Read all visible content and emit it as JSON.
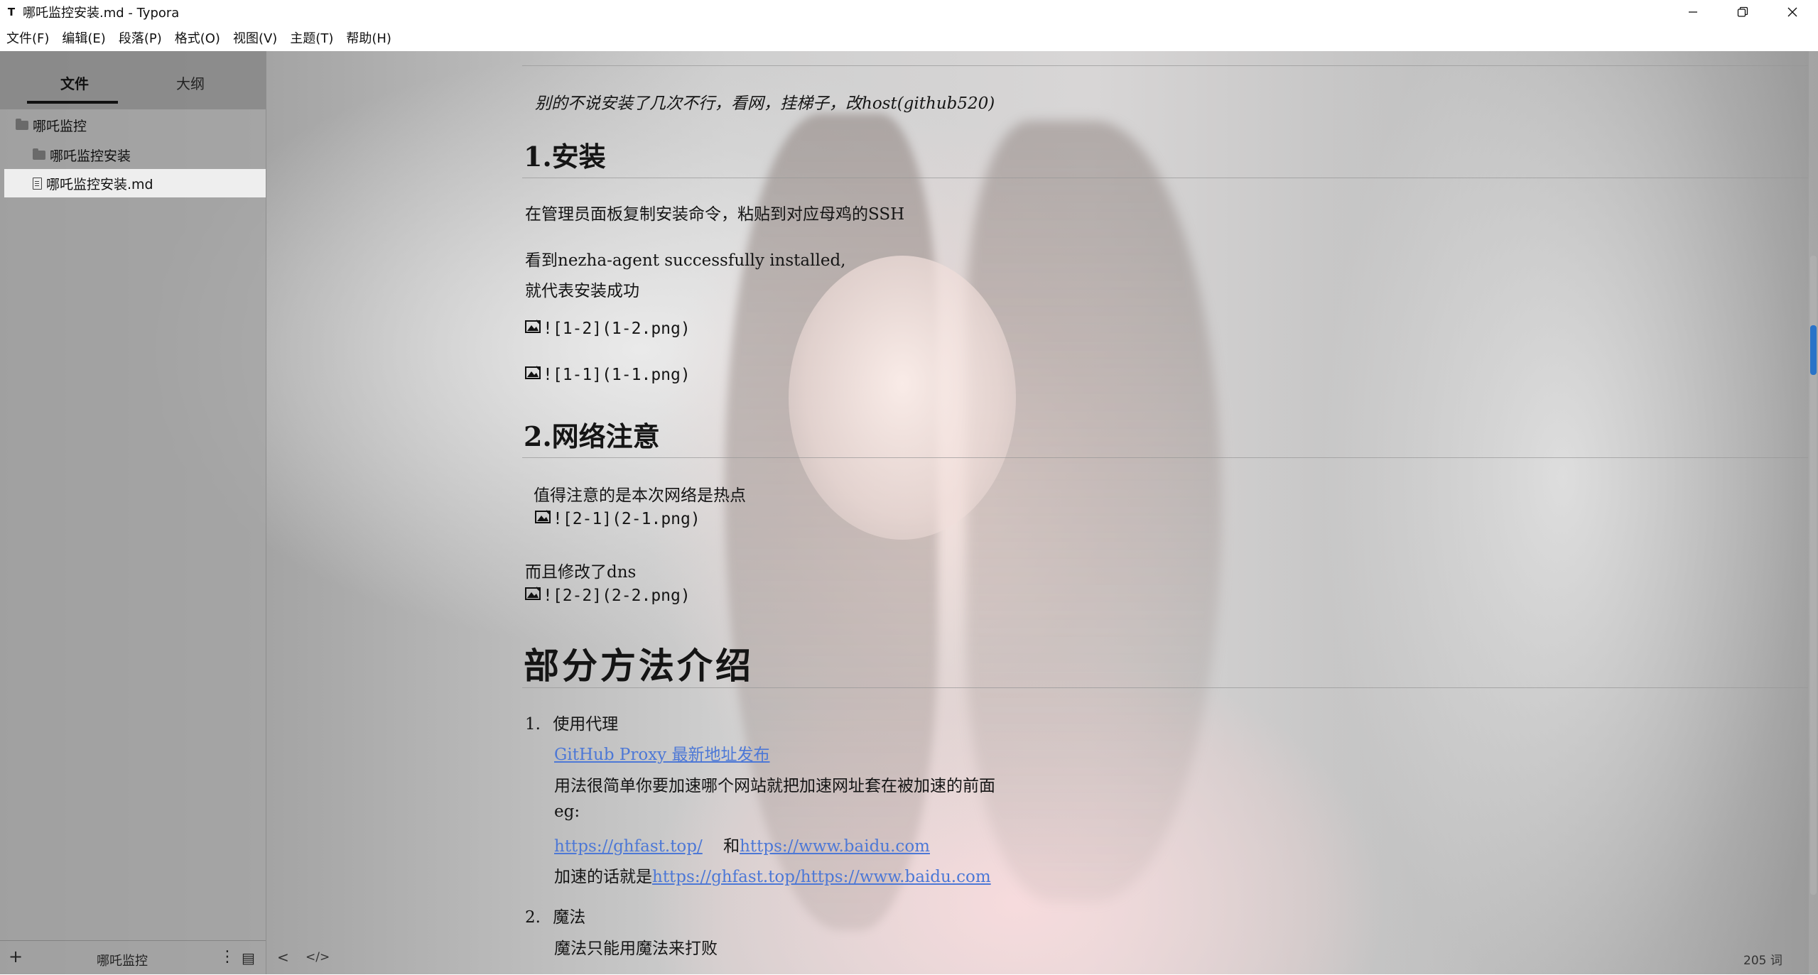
{
  "window": {
    "app_icon": "T",
    "title": "哪吒监控安装.md - Typora"
  },
  "menu": [
    "文件(F)",
    "编辑(E)",
    "段落(P)",
    "格式(O)",
    "视图(V)",
    "主题(T)",
    "帮助(H)"
  ],
  "sidebar": {
    "tabs": [
      "文件",
      "大纲"
    ],
    "active_tab": "文件",
    "tree": {
      "root": "哪吒监控",
      "subfolder": "哪吒监控安装",
      "file": "哪吒监控安装.md"
    },
    "footer": {
      "new_label": "+",
      "folder_name": "哪吒监控",
      "more_label": "⋮",
      "view_label": "▤"
    }
  },
  "document": {
    "intro": "别的不说安装了几次不行，看网，挂梯子，改host(github520)",
    "h_install": "1.安装",
    "install_p1": "在管理员面板复制安装命令，粘贴到对应母鸡的SSH",
    "install_p2_line1": "看到nezha-agent successfully installed,",
    "install_p2_line2": "就代表安装成功",
    "img_1_2": "![1-2](1-2.png)",
    "img_1_1": "![1-1](1-1.png)",
    "h_network": "2.网络注意",
    "network_p1": "值得注意的是本次网络是热点",
    "img_2_1": "![2-1](2-1.png)",
    "network_p2": "而且修改了dns",
    "img_2_2": "![2-2](2-2.png)",
    "h_methods": "部分方法介绍",
    "item1_num": "1.",
    "item1_title": "使用代理",
    "item1_link": "GitHub Proxy 最新地址发布",
    "item1_desc": "用法很简单你要加速哪个网站就把加速网址套在被加速的前面",
    "item1_eg": "eg:",
    "item1_url1": "https://ghfast.top/",
    "item1_and": "和",
    "item1_url2": "https://www.baidu.com",
    "item1_result_prefix": "加速的话就是",
    "item1_result_url": "https://ghfast.top/https://www.baidu.com",
    "item2_num": "2.",
    "item2_title": "魔法",
    "item2_desc": "魔法只能用魔法来打败"
  },
  "status": {
    "word_count": "205 词",
    "source_mode_label": "</>",
    "back_label": "<"
  },
  "colors": {
    "link": "#4d78d6",
    "scroll_thumb_active": "#2a73c8"
  }
}
